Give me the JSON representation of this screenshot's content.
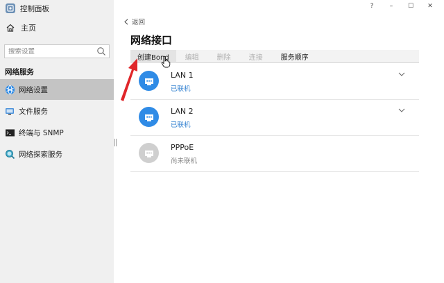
{
  "app": {
    "title": "控制面板"
  },
  "window_controls": {
    "help": "?",
    "minimize": "–",
    "maximize": "☐",
    "close": "✕"
  },
  "sidebar": {
    "home_label": "主页",
    "search_placeholder": "搜索设置",
    "section_label": "网络服务",
    "items": [
      {
        "label": "网络设置",
        "icon": "network-globe-icon",
        "active": true
      },
      {
        "label": "文件服务",
        "icon": "file-service-icon",
        "active": false
      },
      {
        "label": "终端与 SNMP",
        "icon": "terminal-icon",
        "active": false
      },
      {
        "label": "网络探索服务",
        "icon": "discovery-search-icon",
        "active": false
      }
    ]
  },
  "main": {
    "back_label": "返回",
    "title": "网络接口",
    "toolbar": {
      "create_bond": "创建Bond",
      "edit": "编辑",
      "delete": "删除",
      "connect": "连接",
      "service_order": "服务顺序"
    },
    "interfaces": [
      {
        "name": "LAN 1",
        "status": "已联机",
        "connected": true,
        "expandable": true
      },
      {
        "name": "LAN 2",
        "status": "已联机",
        "connected": true,
        "expandable": true
      },
      {
        "name": "PPPoE",
        "status": "尚未联机",
        "connected": false,
        "expandable": false
      }
    ]
  },
  "colors": {
    "accent_blue": "#2f8be6",
    "connected_text": "#2f7fd0",
    "disconnected_icon": "#cfcfcf",
    "disconnected_text": "#8a8a8a",
    "annotation_red": "#e0262a",
    "sidebar_bg": "#f0f0f0",
    "active_item_bg": "#c4c4c4"
  }
}
